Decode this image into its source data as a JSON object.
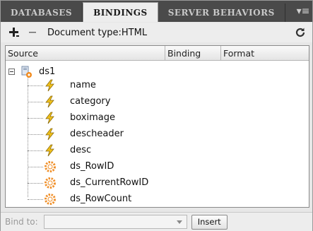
{
  "tabs": [
    {
      "label": "DATABASES",
      "active": false
    },
    {
      "label": "BINDINGS",
      "active": true
    },
    {
      "label": "SERVER BEHAVIORS",
      "active": false
    }
  ],
  "toolbar": {
    "add_icon": "plus-icon",
    "remove_icon": "minus-icon",
    "document_type": "Document type:HTML",
    "refresh_icon": "refresh-icon"
  },
  "table": {
    "columns": [
      "Source",
      "Binding",
      "Format"
    ],
    "root": {
      "label": "ds1",
      "icon": "dataset-icon",
      "expanded": true
    },
    "children": [
      {
        "label": "name",
        "icon": "lightning-icon"
      },
      {
        "label": "category",
        "icon": "lightning-icon"
      },
      {
        "label": "boximage",
        "icon": "lightning-icon"
      },
      {
        "label": "descheader",
        "icon": "lightning-icon"
      },
      {
        "label": "desc",
        "icon": "lightning-icon"
      },
      {
        "label": "ds_RowID",
        "icon": "gear-icon"
      },
      {
        "label": "ds_CurrentRowID",
        "icon": "gear-icon"
      },
      {
        "label": "ds_RowCount",
        "icon": "gear-icon"
      }
    ]
  },
  "bottom": {
    "bind_label": "Bind to:",
    "bind_value": "",
    "insert_label": "Insert"
  },
  "colors": {
    "tab_bar": "#4a4a4a",
    "panel_bg": "#ededed",
    "lightning": "#f2c21b",
    "gear": "#f0902a"
  }
}
